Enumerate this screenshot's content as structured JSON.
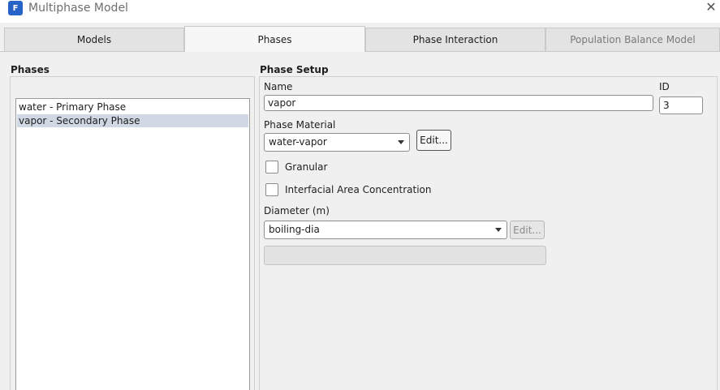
{
  "window": {
    "app_icon_letter": "F",
    "title": "Multiphase Model",
    "close_glyph": "✕"
  },
  "tabs": [
    {
      "label": "Models",
      "active": false,
      "enabled": true
    },
    {
      "label": "Phases",
      "active": true,
      "enabled": true
    },
    {
      "label": "Phase Interaction",
      "active": false,
      "enabled": true
    },
    {
      "label": "Population Balance Model",
      "active": false,
      "enabled": false
    }
  ],
  "phases_panel": {
    "title": "Phases",
    "items": [
      {
        "label": "water - Primary Phase",
        "selected": false
      },
      {
        "label": "vapor - Secondary Phase",
        "selected": true
      }
    ]
  },
  "phase_setup": {
    "title": "Phase Setup",
    "name_label": "Name",
    "name_value": "vapor",
    "id_label": "ID",
    "id_value": "3",
    "material_label": "Phase Material",
    "material_value": "water-vapor",
    "material_edit_label": "Edit...",
    "granular_label": "Granular",
    "granular_checked": false,
    "iac_label": "Interfacial Area Concentration",
    "iac_checked": false,
    "diameter_label": "Diameter (m)",
    "diameter_value": "boiling-dia",
    "diameter_edit_label": "Edit...",
    "diameter_edit_enabled": false
  },
  "icons": {
    "app": "fluent-app-icon",
    "close": "close-icon",
    "dropdown": "chevron-down-icon"
  },
  "colors": {
    "app_icon_bg": "#2563c9",
    "selection_bg": "#cfd8e3",
    "window_bg": "#f0f0f0"
  }
}
